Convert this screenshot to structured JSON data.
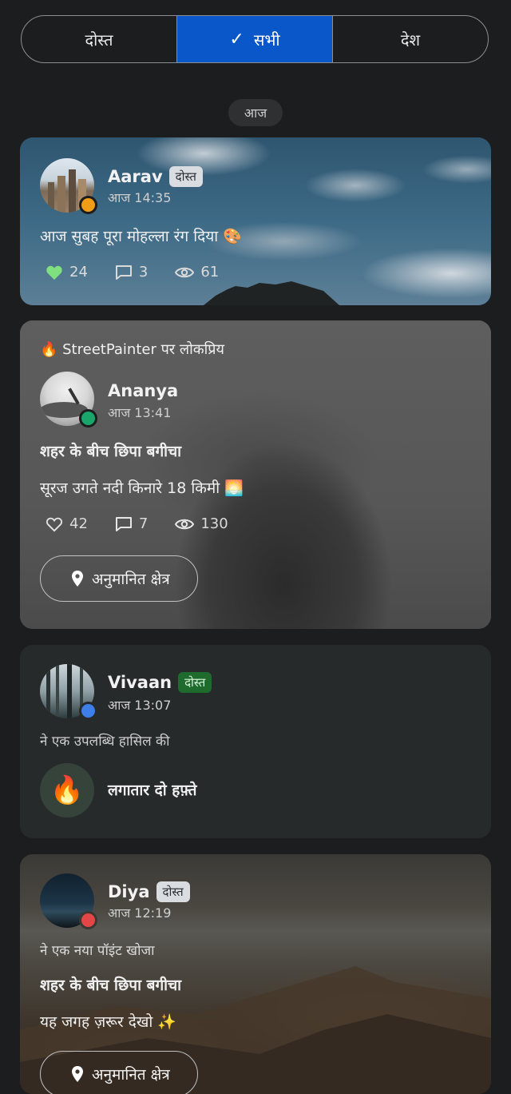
{
  "tabs": [
    {
      "label": "दोस्त",
      "active": false
    },
    {
      "label": "सभी",
      "active": true
    },
    {
      "label": "देश",
      "active": false
    }
  ],
  "date_chip": "आज",
  "posts": [
    {
      "user": "Aarav",
      "badge": "दोस्त",
      "time": "आज 14:35",
      "text": "आज सुबह पूरा मोहल्ला रंग दिया 🎨",
      "likes": "24",
      "comments": "3",
      "views": "61",
      "status_color": "#f29d16"
    },
    {
      "popular": "🔥 StreetPainter पर लोकप्रिय",
      "user": "Ananya",
      "time": "आज 13:41",
      "title": "शहर के बीच छिपा बगीचा",
      "text": "सूरज उगते नदी किनारे 18 किमी 🌅",
      "likes": "42",
      "comments": "7",
      "views": "130",
      "location_label": "अनुमानित क्षेत्र",
      "status_color": "#1aa56b"
    },
    {
      "user": "Vivaan",
      "badge": "दोस्त",
      "time": "आज 13:07",
      "subtitle": "ने एक उपलब्धि हासिल की",
      "achievement_icon": "🔥",
      "achievement": "लगातार दो हफ़्ते",
      "status_color": "#3d7ee8"
    },
    {
      "user": "Diya",
      "badge": "दोस्त",
      "time": "आज 12:19",
      "subtitle": "ने एक नया पॉइंट खोजा",
      "title": "शहर के बीच छिपा बगीचा",
      "text": "यह जगह ज़रूर देखो ✨",
      "location_label": "अनुमानित क्षेत्र",
      "status_color": "#e24646"
    }
  ]
}
